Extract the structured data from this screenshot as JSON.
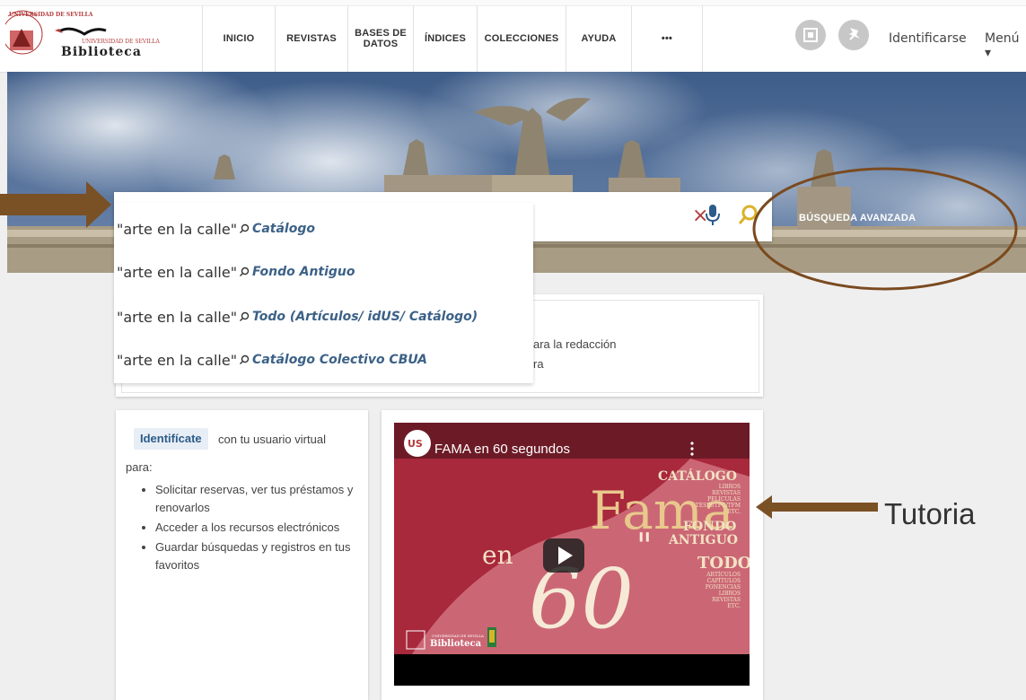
{
  "header": {
    "logo_seal": "UNIVERSIDAD DE SEVILLA",
    "logo_sub": "UNIVERSIDAD DE SEVILLA",
    "logo_title": "Biblioteca",
    "nav": [
      {
        "label": "INICIO"
      },
      {
        "label": "REVISTAS"
      },
      {
        "label": "BASES DE",
        "label2": "DATOS"
      },
      {
        "label": "ÍNDICES"
      },
      {
        "label": "COLECCIONES"
      },
      {
        "label": "AYUDA"
      },
      {
        "label": "•••"
      }
    ],
    "login_label": "Identificarse",
    "menu_label": "Menú ▾"
  },
  "search": {
    "clear_icon": "×",
    "advanced_label": "BÚSQUEDA AVANZADA",
    "suggestions": [
      {
        "query": "\"arte en la calle\"",
        "target": "Catálogo"
      },
      {
        "query": "\"arte en la calle\"",
        "target": "Fondo Antiguo"
      },
      {
        "query": "\"arte en la calle\"",
        "target": "Todo (Artículos/ idUS/ Catálogo)"
      },
      {
        "query": "\"arte en la calle\"",
        "target": "Catálogo Colectivo CBUA"
      }
    ]
  },
  "news_card": {
    "link_fragment": "a",
    "line1": "ara la redacción",
    "line2": "ra"
  },
  "login_card": {
    "button": "Identifícate",
    "text": "con tu usuario virtual",
    "para": "para:",
    "features": [
      "Solicitar reservas, ver tus préstamos y renovarlos",
      "Acceder a los recursos electrónicos",
      "Guardar búsquedas y registros en tus favoritos"
    ]
  },
  "video": {
    "channel": "US",
    "title": "FAMA en 60 segundos",
    "art_fama": "Fama",
    "art_en": "en",
    "art_60": "60",
    "art_quote": "\"",
    "art_catalogo": "CATÁLOGO",
    "art_catalogo_sub": [
      "LIBROS",
      "REVISTAS",
      "PELÍCULAS",
      "TESIS/TFG/TFM",
      "ETC."
    ],
    "art_fondo": "FONDO",
    "art_antiguo": "ANTIGUO",
    "art_todo": "TODO",
    "art_todo_sub": [
      "ARTÍCULOS",
      "CAPÍTULOS",
      "PONENCIAS",
      "LIBROS",
      "REVISTAS",
      "ETC."
    ],
    "art_biblioteca": "Biblioteca",
    "art_us_sub": "UNIVERSIDAD DE SEVILLA"
  },
  "annotations": {
    "tutorial_label": "Tutoria"
  },
  "colors": {
    "accent": "#b43a3a",
    "link": "#3c6187",
    "arrow": "#7a5025",
    "video_red": "#a8283c"
  }
}
